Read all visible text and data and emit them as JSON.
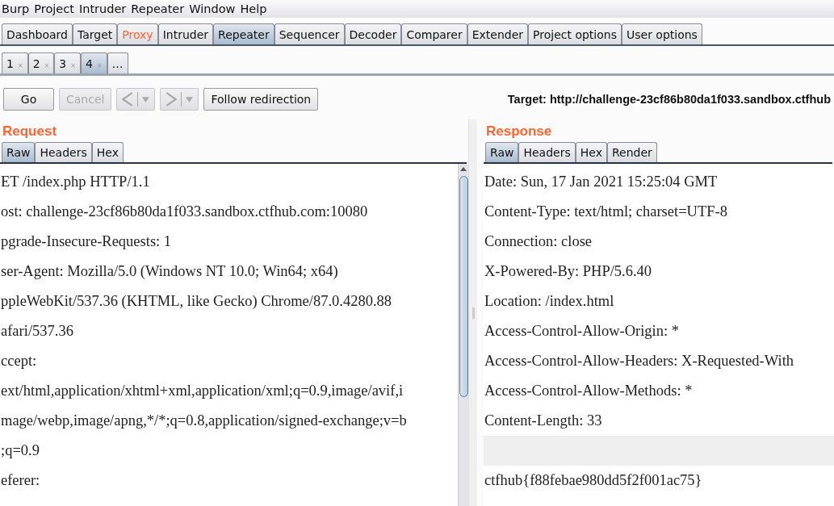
{
  "menu": [
    "Burp",
    "Project",
    "Intruder",
    "Repeater",
    "Window",
    "Help"
  ],
  "main_tabs": [
    {
      "label": "Dashboard",
      "selected": false,
      "highlighted": false
    },
    {
      "label": "Target",
      "selected": false,
      "highlighted": false
    },
    {
      "label": "Proxy",
      "selected": false,
      "highlighted": true
    },
    {
      "label": "Intruder",
      "selected": false,
      "highlighted": false
    },
    {
      "label": "Repeater",
      "selected": true,
      "highlighted": false
    },
    {
      "label": "Sequencer",
      "selected": false,
      "highlighted": false
    },
    {
      "label": "Decoder",
      "selected": false,
      "highlighted": false
    },
    {
      "label": "Comparer",
      "selected": false,
      "highlighted": false
    },
    {
      "label": "Extender",
      "selected": false,
      "highlighted": false
    },
    {
      "label": "Project options",
      "selected": false,
      "highlighted": false
    },
    {
      "label": "User options",
      "selected": false,
      "highlighted": false
    }
  ],
  "repeater_tabs": [
    {
      "label": "1",
      "close": "×",
      "selected": false
    },
    {
      "label": "2",
      "close": "×",
      "selected": false
    },
    {
      "label": "3",
      "close": "×",
      "selected": false
    },
    {
      "label": "4",
      "close": "×",
      "selected": true
    },
    {
      "label": "…",
      "selected": false
    }
  ],
  "toolbar": {
    "go": {
      "label": "Go",
      "disabled": false
    },
    "cancel": {
      "label": "Cancel",
      "disabled": true
    },
    "back": {
      "disabled": true
    },
    "forward": {
      "disabled": true
    },
    "follow": {
      "label": "Follow redirection",
      "disabled": false
    },
    "target": "Target: http://challenge-23cf86b80da1f033.sandbox.ctfhub"
  },
  "request": {
    "title": "Request",
    "tabs": [
      {
        "label": "Raw",
        "selected": true
      },
      {
        "label": "Headers",
        "selected": false
      },
      {
        "label": "Hex",
        "selected": false
      }
    ],
    "lines": [
      {
        "text": "ET /index.php HTTP/1.1",
        "highlighted": false
      },
      {
        "text": "ost: challenge-23cf86b80da1f033.sandbox.ctfhub.com:10080",
        "highlighted": false
      },
      {
        "text": "pgrade-Insecure-Requests: 1",
        "highlighted": false
      },
      {
        "text": "ser-Agent: Mozilla/5.0 (Windows NT 10.0; Win64; x64)",
        "highlighted": false
      },
      {
        "text": "ppleWebKit/537.36 (KHTML, like Gecko) Chrome/87.0.4280.88",
        "highlighted": false
      },
      {
        "text": "afari/537.36",
        "highlighted": false
      },
      {
        "text": "ccept:",
        "highlighted": false
      },
      {
        "text": "ext/html,application/xhtml+xml,application/xml;q=0.9,image/avif,i",
        "highlighted": false
      },
      {
        "text": "mage/webp,image/apng,*/*;q=0.8,application/signed-exchange;v=b",
        "highlighted": false
      },
      {
        "text": ";q=0.9",
        "highlighted": false
      },
      {
        "text": "eferer:",
        "highlighted": false
      }
    ]
  },
  "response": {
    "title": "Response",
    "tabs": [
      {
        "label": "Raw",
        "selected": true
      },
      {
        "label": "Headers",
        "selected": false
      },
      {
        "label": "Hex",
        "selected": false
      },
      {
        "label": "Render",
        "selected": false
      }
    ],
    "lines": [
      {
        "text": "Date: Sun, 17 Jan 2021 15:25:04 GMT",
        "highlighted": false
      },
      {
        "text": "Content-Type: text/html; charset=UTF-8",
        "highlighted": false
      },
      {
        "text": "Connection: close",
        "highlighted": false
      },
      {
        "text": "X-Powered-By: PHP/5.6.40",
        "highlighted": false
      },
      {
        "text": "Location: /index.html",
        "highlighted": false
      },
      {
        "text": "Access-Control-Allow-Origin: *",
        "highlighted": false
      },
      {
        "text": "Access-Control-Allow-Headers: X-Requested-With",
        "highlighted": false
      },
      {
        "text": "Access-Control-Allow-Methods: *",
        "highlighted": false
      },
      {
        "text": "Content-Length: 33",
        "highlighted": false
      },
      {
        "highlighted": true
      },
      {
        "text": "ctfhub{f88febae980dd5f2f001ac75}",
        "highlighted": false
      }
    ]
  }
}
